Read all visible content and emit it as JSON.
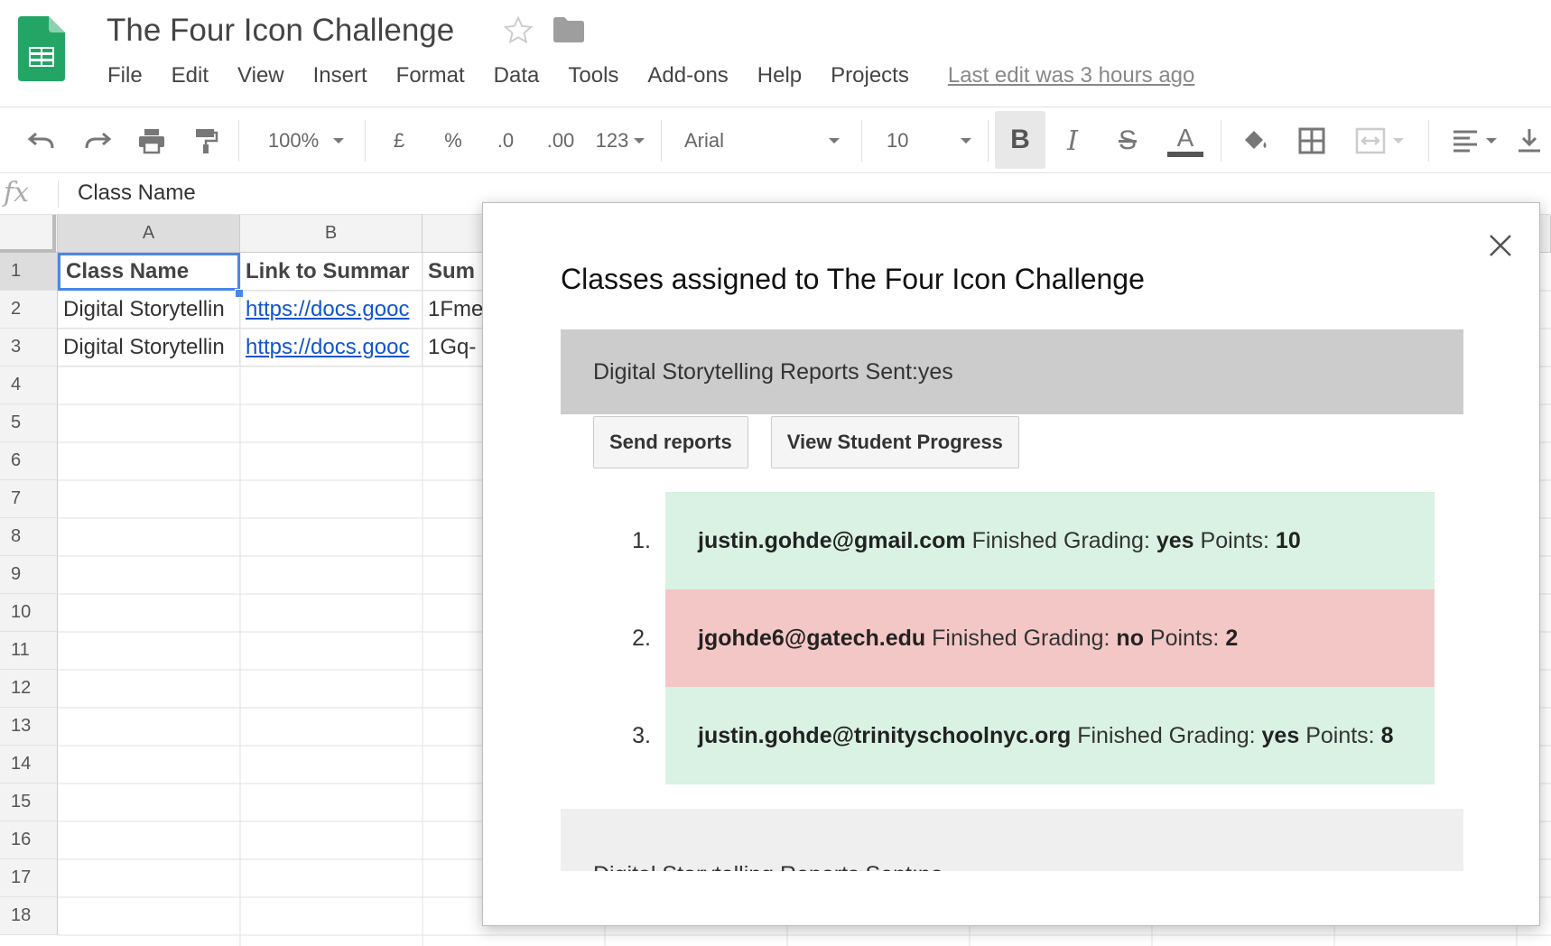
{
  "window": {
    "doc_title": "The Four Icon Challenge",
    "menu": [
      "File",
      "Edit",
      "View",
      "Insert",
      "Format",
      "Data",
      "Tools",
      "Add-ons",
      "Help",
      "Projects"
    ],
    "last_edit": "Last edit was 3 hours ago"
  },
  "toolbar": {
    "zoom": "100%",
    "currency": "£",
    "percent": "%",
    "decimal_less": ".0",
    "decimal_more": ".00",
    "more_formats": "123",
    "font": "Arial",
    "font_size": "10"
  },
  "formula_bar": {
    "fx": "fx",
    "value": "Class Name"
  },
  "grid": {
    "columns": [
      "A",
      "B"
    ],
    "rows": [
      "1",
      "2",
      "3",
      "4",
      "5",
      "6",
      "7",
      "8",
      "9",
      "10",
      "11",
      "12",
      "13",
      "14",
      "15",
      "16",
      "17",
      "18"
    ],
    "header_row": [
      "Class Name",
      "Link to Summar",
      "Sum"
    ],
    "row2": [
      "Digital Storytellin",
      "https://docs.gooc",
      "1Fme"
    ],
    "row3": [
      "Digital Storytellin",
      "https://docs.gooc",
      "1Gq-"
    ]
  },
  "dialog": {
    "title": "Classes assigned to The Four Icon Challenge",
    "classes": [
      {
        "header": "Digital Storytelling Reports Sent:yes",
        "buttons": [
          "Send reports",
          "View Student Progress"
        ],
        "students": [
          {
            "num": "1.",
            "email": "justin.gohde@gmail.com",
            "grading_label": "Finished Grading:",
            "grading": "yes",
            "points_label": "Points:",
            "points": "10"
          },
          {
            "num": "2.",
            "email": "jgohde6@gatech.edu",
            "grading_label": "Finished Grading:",
            "grading": "no",
            "points_label": "Points:",
            "points": "2"
          },
          {
            "num": "3.",
            "email": "justin.gohde@trinityschoolnyc.org",
            "grading_label": "Finished Grading:",
            "grading": "yes",
            "points_label": "Points:",
            "points": "8"
          }
        ]
      },
      {
        "header": "Digital Storytelling Reports Sent:no"
      }
    ]
  },
  "colors": {
    "sheets_green": "#0f9d58",
    "finished_bg": "#d9f2e3",
    "unfinished_bg": "#f4c7c7",
    "active_header_bg": "#cccccc",
    "inactive_header_bg": "#efefef",
    "selection_blue": "#4a86e8"
  },
  "icons": [
    "sheets-logo-icon",
    "star-icon",
    "folder-icon",
    "undo-icon",
    "redo-icon",
    "print-icon",
    "paint-format-icon",
    "bold-icon",
    "italic-icon",
    "strikethrough-icon",
    "text-color-icon",
    "fill-color-icon",
    "borders-icon",
    "merge-cells-icon",
    "align-left-icon",
    "vertical-align-icon",
    "close-icon"
  ]
}
